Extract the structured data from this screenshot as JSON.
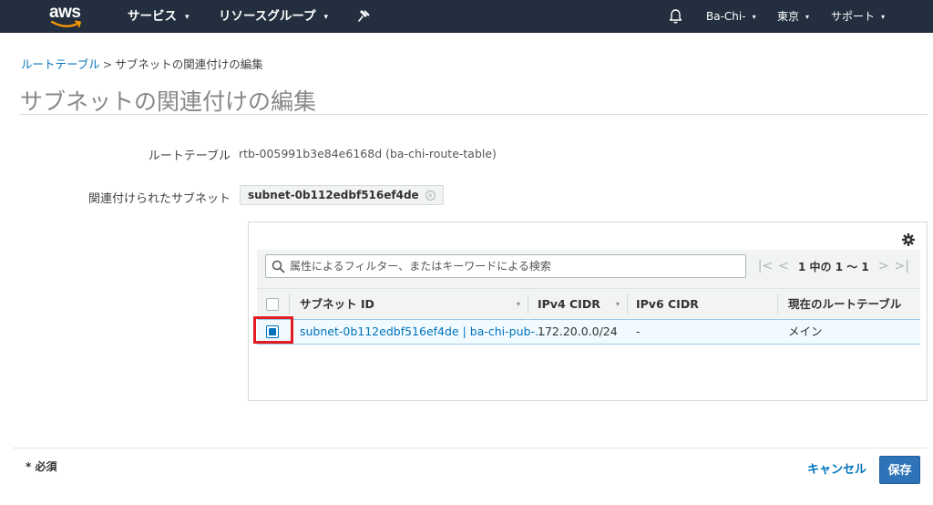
{
  "nav": {
    "logo_text": "aws",
    "services": "サービス",
    "resource_groups": "リソースグループ",
    "account": "Ba-Chi-",
    "region": "東京",
    "support": "サポート",
    "caret": "▾"
  },
  "breadcrumb": {
    "parent": "ルートテーブル",
    "separator": ">",
    "current": "サブネットの関連付けの編集"
  },
  "page_title": "サブネットの関連付けの編集",
  "form": {
    "route_table_label": "ルートテーブル",
    "route_table_value": "rtb-005991b3e84e6168d (ba-chi-route-table)",
    "associated_label": "関連付けられたサブネット",
    "associated_token": "subnet-0b112edbf516ef4de",
    "token_remove": "×"
  },
  "table": {
    "search_placeholder": "属性によるフィルター、またはキーワードによる検索",
    "pager": {
      "first": "|<",
      "prev": "<",
      "text": "1 中の 1 ～ 1",
      "next": ">",
      "last": ">|"
    },
    "columns": [
      "サブネット ID",
      "IPv4 CIDR",
      "IPv6 CIDR",
      "現在のルートテーブル"
    ],
    "rows": [
      {
        "subnet": "subnet-0b112edbf516ef4de | ba-chi-pub-...",
        "ipv4": "172.20.0.0/24",
        "ipv6": "-",
        "route_table": "メイン",
        "selected": true
      }
    ]
  },
  "footer": {
    "required": "* 必須",
    "cancel": "キャンセル",
    "save": "保存"
  },
  "colors": {
    "nav_bg": "#232f3e",
    "link": "#0073bb",
    "primary_button": "#2e73b8",
    "highlight": "#e31b23",
    "selected_row": "#f1faff"
  }
}
